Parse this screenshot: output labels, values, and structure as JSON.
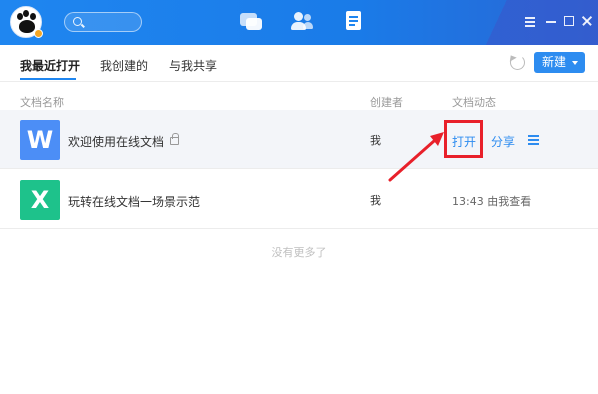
{
  "titlebar": {
    "logo_icon": "paw-logo-icon",
    "search_icon": "search-icon",
    "nav_icons": [
      "chat-icon",
      "contacts-icon",
      "documents-icon"
    ],
    "window_controls": [
      "menu-icon",
      "minimize-icon",
      "maximize-icon",
      "close-icon"
    ],
    "colors": {
      "bar": "#1f86f0",
      "accent": "#2d8cf0"
    }
  },
  "tabs": [
    {
      "label": "我最近打开",
      "active": true
    },
    {
      "label": "我创建的",
      "active": false
    },
    {
      "label": "与我共享",
      "active": false
    }
  ],
  "toolbar": {
    "refresh_icon": "refresh-icon",
    "new_label": "新建"
  },
  "columns": {
    "name": "文档名称",
    "creator": "创建者",
    "activity": "文档动态"
  },
  "rows": [
    {
      "icon_letter": "W",
      "icon_color": "#4c8ef6",
      "name": "欢迎使用在线文档",
      "locked": true,
      "creator": "我",
      "open_label": "打开",
      "share_label": "分享"
    },
    {
      "icon_letter": "X",
      "icon_color": "#1ec28b",
      "name": "玩转在线文档一场景示范",
      "creator": "我",
      "activity": "13:43 由我查看"
    }
  ],
  "footer": {
    "no_more": "没有更多了"
  },
  "annotation": {
    "highlight_color": "#e8202a"
  }
}
